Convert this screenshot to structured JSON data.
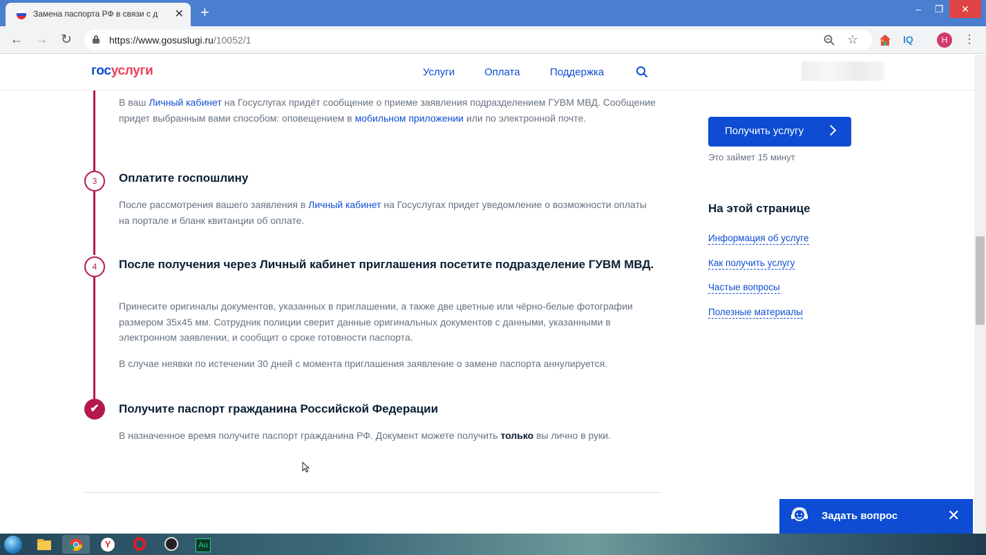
{
  "browser": {
    "tab_title": "Замена паспорта РФ в связи с д",
    "tab_close": "✕",
    "new_tab": "+",
    "url_host": "https://www.gosuslugi.ru",
    "url_path": "/10052/1",
    "profile_initial": "Н",
    "window_controls": [
      "–",
      "❐",
      "✕"
    ],
    "extension_iq": "IQ"
  },
  "header": {
    "logo_part1": "гос",
    "logo_part2": "услуги",
    "nav": [
      "Услуги",
      "Оплата",
      "Поддержка"
    ]
  },
  "steps": {
    "step2": {
      "text_before": "В ваш ",
      "link1": "Личный кабинет",
      "text_mid": " на Госуслугах придёт сообщение о приеме заявления подразделением ГУВМ МВД. Сообщение придет выбранным вами способом: оповещением в ",
      "link2": "мобильном приложении",
      "text_after": " или по электронной почте."
    },
    "step3": {
      "number": "3",
      "title": "Оплатите госпошлину",
      "text_before": "После рассмотрения вашего заявления в ",
      "link": "Личный кабинет",
      "text_after": " на Госуслугах придет уведомление о возможности оплаты на портале и бланк квитанции об оплате."
    },
    "step4": {
      "number": "4",
      "title": "После получения через Личный кабинет приглашения посетите подразделение ГУВМ МВД.",
      "text1": "Принесите оригиналы документов, указанных в приглашении, а также две цветные или чёрно-белые фотографии размером 35х45 мм. Сотрудник полиции сверит данные оригинальных документов с данными, указанными в электронном заявлении, и сообщит о сроке готовности паспорта.",
      "text2": "В случае неявки по истечении 30 дней с момента приглашения заявление о замене паспорта аннулируется."
    },
    "step5": {
      "check": "✔",
      "title": "Получите паспорт гражданина Российской Федерации",
      "text_before": "В назначенное время получите паспорт гражданина РФ. Документ можете получить ",
      "text_bold": "только",
      "text_after": " вы лично в руки."
    }
  },
  "sidebar": {
    "button_label": "Получить услугу",
    "time_note": "Это займет 15 минут",
    "heading": "На этой странице",
    "links": [
      "Информация об услуге",
      "Как получить услугу",
      "Частые вопросы",
      "Полезные материалы"
    ]
  },
  "ask": {
    "label": "Задать вопрос",
    "close": "✕"
  },
  "taskbar": {
    "apps": [
      "file-explorer",
      "chrome",
      "yandex-browser",
      "opera",
      "obs",
      "audition"
    ],
    "audition_label": "Au",
    "yandex_label": "Y"
  },
  "colors": {
    "accent_blue": "#0d4cd3",
    "timeline_red": "#b3194c",
    "logo_red": "#ee3f58",
    "chrome_blue": "#4a7fd0"
  }
}
